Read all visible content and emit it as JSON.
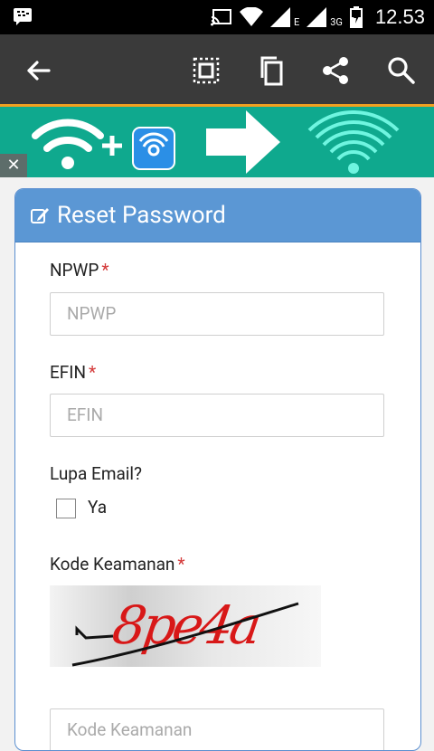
{
  "status_bar": {
    "network_type": "E",
    "network_type_2": "3G",
    "time": "12.53"
  },
  "toolbar": {
    "icons": [
      "back-arrow-icon",
      "select-all-icon",
      "copy-icon",
      "share-icon",
      "search-icon"
    ]
  },
  "banner": {
    "close_label": "✕"
  },
  "form": {
    "title": "Reset Password",
    "npwp_label": "NPWP",
    "npwp_placeholder": "NPWP",
    "efin_label": "EFIN",
    "efin_placeholder": "EFIN",
    "lupa_email_label": "Lupa Email?",
    "ya_label": "Ya",
    "kode_keamanan_label": "Kode Keamanan",
    "captcha_text": "8pe4a",
    "kode_placeholder": "Kode Keamanan",
    "required_mark": "*"
  },
  "colors": {
    "header_blue": "#5b97d4",
    "toolbar": "#3a3a3a",
    "accent": "#f0a020",
    "banner": "#0fa98e",
    "required": "#d43a3a"
  }
}
